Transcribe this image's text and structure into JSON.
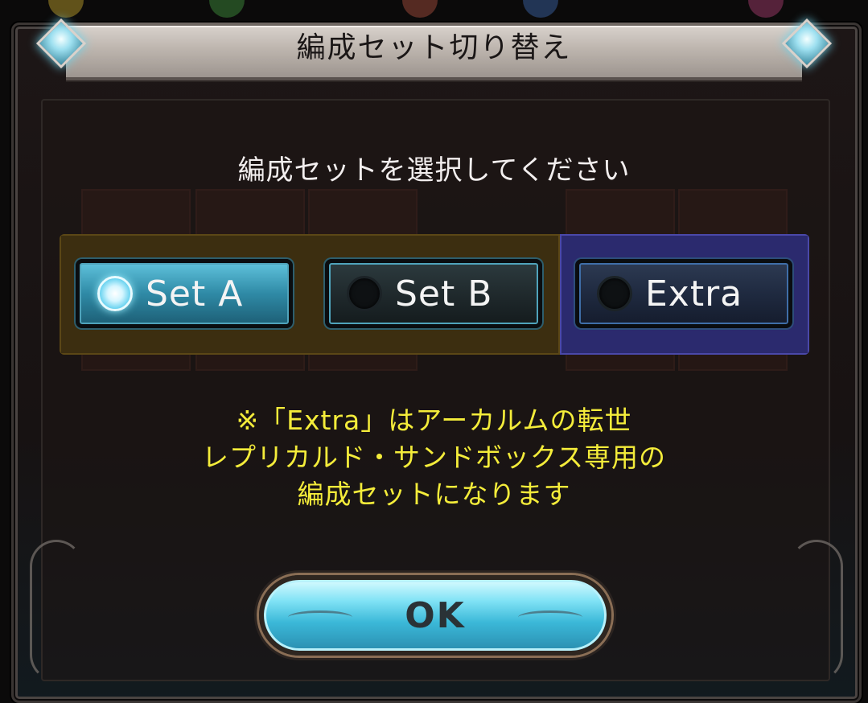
{
  "dialog": {
    "title": "編成セット切り替え",
    "prompt": "編成セットを選択してください",
    "options": [
      {
        "label": "Set A",
        "selected": true
      },
      {
        "label": "Set B",
        "selected": false
      },
      {
        "label": "Extra",
        "selected": false
      }
    ],
    "note_lines": [
      "※「Extra」はアーカルムの転世",
      "レプリカルド・サンドボックス専用の",
      "編成セットになります"
    ],
    "ok_label": "OK"
  },
  "colors": {
    "accent_cyan": "#3bb8d8",
    "note_yellow": "#f4ec3a",
    "band_gold": "#3c2e10",
    "band_blue": "#2b2a6e"
  }
}
